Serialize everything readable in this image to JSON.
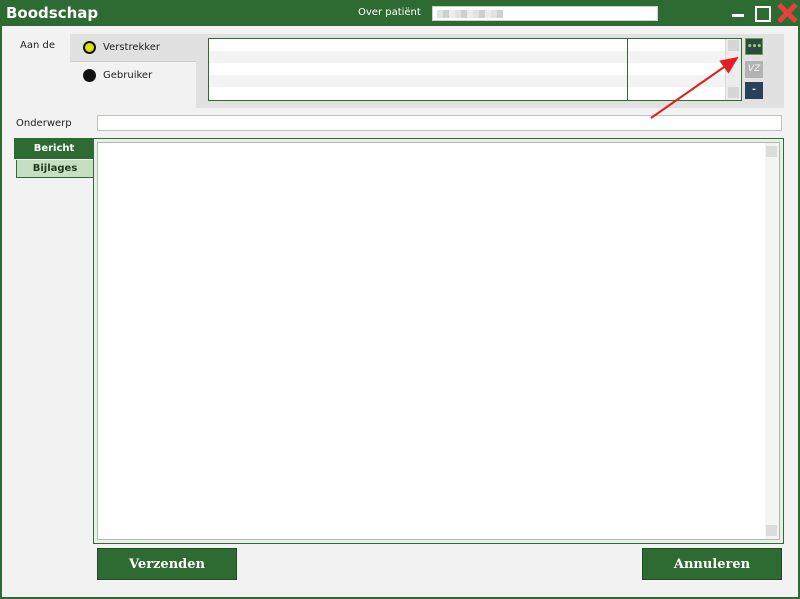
{
  "window": {
    "title": "Boodschap",
    "patient_label": "Over patiënt",
    "patient_value": ""
  },
  "recipient": {
    "label": "Aan de",
    "options": [
      {
        "label": "Verstrekker",
        "selected": true
      },
      {
        "label": "Gebruiker",
        "selected": false
      }
    ],
    "buttons": {
      "select": "•••",
      "vz": "VZ",
      "remove": "-"
    }
  },
  "subject": {
    "label": "Onderwerp",
    "value": ""
  },
  "tabs": [
    {
      "label": "Bericht",
      "active": true
    },
    {
      "label": "Bijlages",
      "active": false
    }
  ],
  "actions": {
    "send": "Verzenden",
    "cancel": "Annuleren"
  },
  "colors": {
    "brand_green": "#2e6b32",
    "radio_active": "#d5e600",
    "annotation_arrow": "#e02020"
  }
}
